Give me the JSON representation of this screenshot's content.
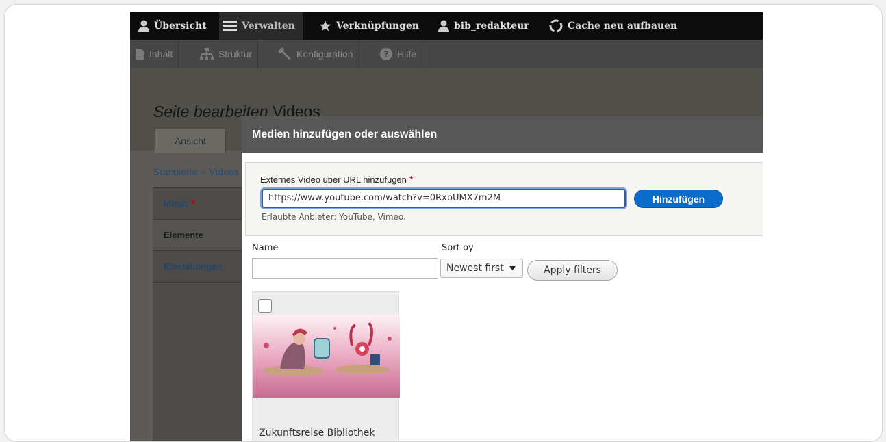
{
  "toolbar": {
    "items": [
      {
        "label": "Übersicht",
        "icon": "person-icon"
      },
      {
        "label": "Verwalten",
        "icon": "menu-icon"
      },
      {
        "label": "Verknüpfungen",
        "icon": "star-icon"
      },
      {
        "label": "bib_redakteur",
        "icon": "person-icon"
      },
      {
        "label": "Cache neu aufbauen",
        "icon": "recycle-icon"
      }
    ]
  },
  "admin_menu": {
    "items": [
      {
        "label": "Inhalt",
        "icon": "document-icon"
      },
      {
        "label": "Struktur",
        "icon": "sitemap-icon"
      },
      {
        "label": "Konfiguration",
        "icon": "wrench-icon"
      },
      {
        "label": "Hilfe",
        "icon": "help-icon"
      }
    ]
  },
  "page": {
    "title_em": "Seite bearbeiten",
    "title_rest": " Videos",
    "tab_view": "Ansicht",
    "breadcrumb": "Startseite » Videos"
  },
  "sidenav": {
    "items": [
      {
        "label": "Inhalt",
        "required": "*"
      },
      {
        "label": "Elemente"
      },
      {
        "label": "Einstellungen"
      }
    ]
  },
  "modal": {
    "title": "Medien hinzufügen oder auswählen",
    "url_label": "Externes Video über URL hinzufügen",
    "required_mark": "*",
    "url_value": "https://www.youtube.com/watch?v=0RxbUMX7m2M",
    "add_button": "Hinzufügen",
    "url_description": "Erlaubte Anbieter: YouTube, Vimeo.",
    "filters": {
      "name_label": "Name",
      "name_value": "",
      "sort_label": "Sort by",
      "sort_value": "Newest first",
      "apply_button": "Apply filters"
    },
    "media_items": [
      {
        "caption": "Zukunftsreise Bibliothek",
        "selected": false
      }
    ]
  },
  "colors": {
    "accent": "#0a6dcc",
    "toolbar_bg": "#0c0c0c",
    "required": "#c30000"
  }
}
